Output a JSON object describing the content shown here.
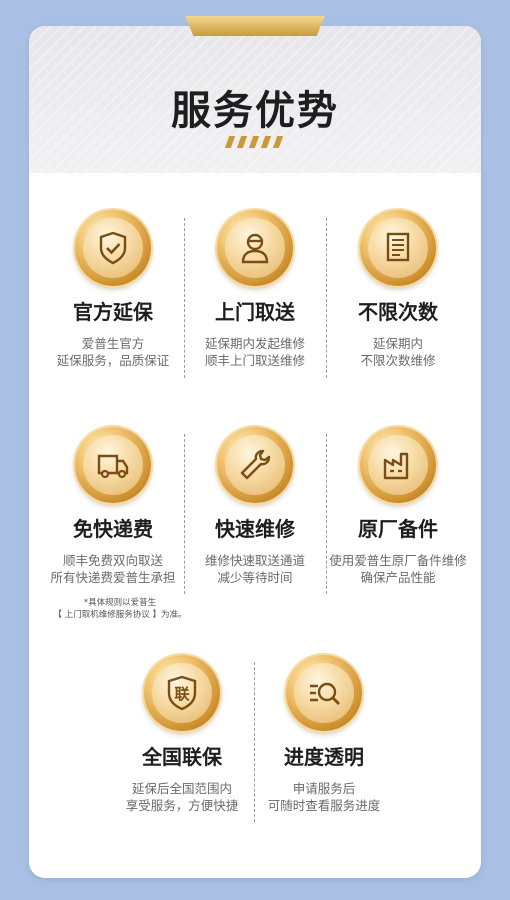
{
  "title": "服务优势",
  "items": [
    {
      "icon": "shield-check-icon",
      "title": "官方延保",
      "desc": "爱普生官方\n延保服务，品质保证"
    },
    {
      "icon": "technician-icon",
      "title": "上门取送",
      "desc": "延保期内发起维修\n顺丰上门取送维修"
    },
    {
      "icon": "document-icon",
      "title": "不限次数",
      "desc": "延保期内\n不限次数维修"
    },
    {
      "icon": "delivery-truck-icon",
      "title": "免快递费",
      "desc": "顺丰免费双向取送\n所有快递费爱普生承担"
    },
    {
      "icon": "wrench-icon",
      "title": "快速维修",
      "desc": "维修快速取送通道\n减少等待时间"
    },
    {
      "icon": "factory-icon",
      "title": "原厂备件",
      "desc": "使用爱普生原厂备件维修\n确保产品性能"
    },
    {
      "icon": "union-shield-icon",
      "title": "全国联保",
      "desc": "延保后全国范围内\n享受服务，方便快捷",
      "glyph": "联"
    },
    {
      "icon": "search-progress-icon",
      "title": "进度透明",
      "desc": "申请服务后\n可随时查看服务进度"
    }
  ],
  "note": "*具体规则以爱普生\n【 上门取机维修服务协议 】为准。"
}
